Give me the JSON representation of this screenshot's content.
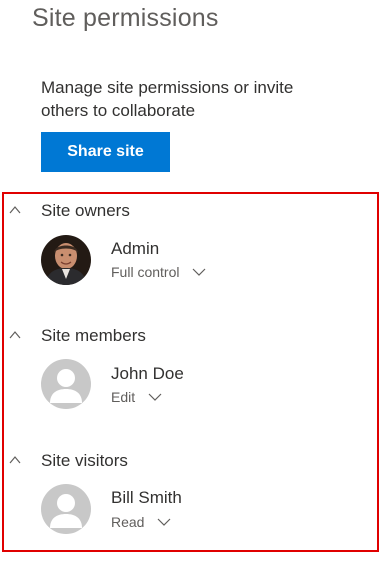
{
  "panel": {
    "title": "Site permissions",
    "description": "Manage site permissions or invite others to collaborate",
    "share_button": "Share site"
  },
  "colors": {
    "accent": "#0078d4",
    "highlight": "#e00000"
  },
  "sections": [
    {
      "title": "Site owners",
      "icon": "chevron-up-icon",
      "members": [
        {
          "name": "Admin",
          "permission": "Full control",
          "avatar": "photo"
        }
      ]
    },
    {
      "title": "Site members",
      "icon": "chevron-up-icon",
      "members": [
        {
          "name": "John Doe",
          "permission": "Edit",
          "avatar": "placeholder"
        }
      ]
    },
    {
      "title": "Site visitors",
      "icon": "chevron-up-icon",
      "members": [
        {
          "name": "Bill Smith",
          "permission": "Read",
          "avatar": "placeholder"
        }
      ]
    }
  ]
}
